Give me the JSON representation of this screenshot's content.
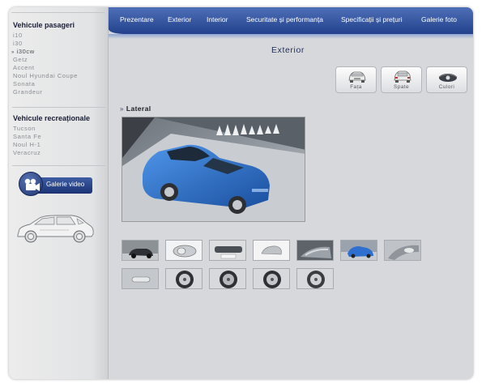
{
  "sidebar": {
    "section1_title": "Vehicule pasageri",
    "passenger": [
      {
        "label": "i10"
      },
      {
        "label": "i30"
      },
      {
        "label": "i30cw",
        "active": true
      },
      {
        "label": "Getz"
      },
      {
        "label": "Accent"
      },
      {
        "label": "Noul Hyundai Coupe"
      },
      {
        "label": "Sonata"
      },
      {
        "label": "Grandeur"
      }
    ],
    "section2_title": "Vehicule recreaționale",
    "recreational": [
      {
        "label": "Tucson"
      },
      {
        "label": "Santa Fe"
      },
      {
        "label": "Noul H-1"
      },
      {
        "label": "Veracruz"
      }
    ],
    "video_button": "Galerie video"
  },
  "nav": {
    "items": [
      "Prezentare",
      "Exterior",
      "Interior",
      "Securitate și performanța",
      "Specificații și prețuri",
      "Galerie foto"
    ]
  },
  "main": {
    "title": "Exterior",
    "view_buttons": [
      "Fața",
      "Spate",
      "Culori"
    ],
    "section_label": "Lateral"
  },
  "colors": {
    "nav_blue": "#2b4a95",
    "car_blue": "#2f6fd0",
    "page_bg": "#d6d8dc"
  }
}
